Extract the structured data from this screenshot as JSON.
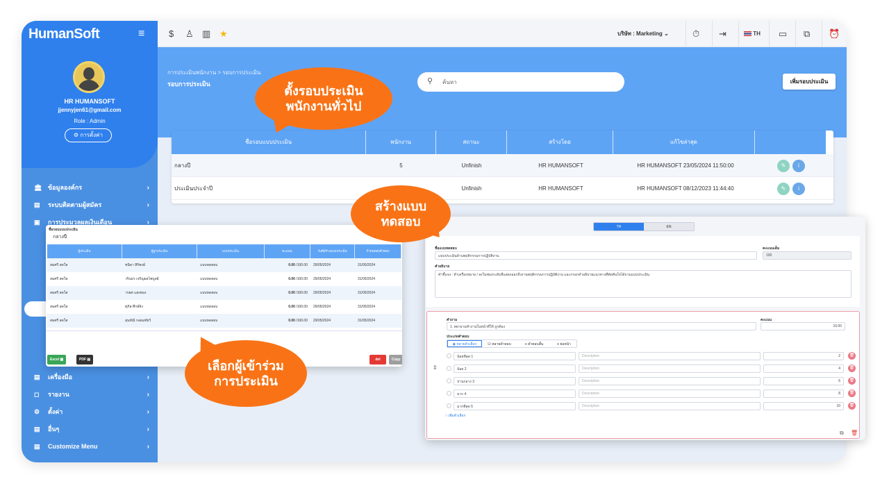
{
  "brand": "HumanSoft",
  "user": {
    "name": "HR HUMANSOFT",
    "email": "jjennyjen61@gmail.com",
    "role": "Role : Admin",
    "settings_label": "การตั้งค่า"
  },
  "sidebar": {
    "items": [
      {
        "label": "ข้อมูลองค์กร",
        "icon": "building-icon"
      },
      {
        "label": "ระบบติดตามผู้สมัคร",
        "icon": "briefcase-icon"
      },
      {
        "label": "การประมวลผลเงินเดือน",
        "icon": "payroll-icon"
      }
    ],
    "items_bottom": [
      {
        "label": "เครื่องมือ",
        "icon": "tools-icon"
      },
      {
        "label": "รายงาน",
        "icon": "report-icon"
      },
      {
        "label": "ตั้งค่า",
        "icon": "gear-icon"
      },
      {
        "label": "อื่นๆ",
        "icon": "more-icon"
      },
      {
        "label": "Customize Menu",
        "icon": "customize-icon"
      }
    ]
  },
  "topbar": {
    "company": "บริษัท : Marketing",
    "language": "TH",
    "icons": [
      "dollar-icon",
      "user-icon",
      "columns-icon",
      "star-icon",
      "timer-icon",
      "login-icon",
      "flag-icon",
      "chat-icon",
      "add-window-icon",
      "alarm-icon"
    ]
  },
  "header": {
    "breadcrumb": "การประเมินพนักงาน > รอบการประเมิน",
    "title": "รอบการประเมิน",
    "search_placeholder": "ค้นหา",
    "add_button": "เพิ่มรอบประเมิน"
  },
  "table": {
    "columns": [
      "ชื่อรอบแบบประเมิน",
      "พนักงาน",
      "สถานะ",
      "สร้างโดย",
      "แก้ไขล่าสุด"
    ],
    "rows": [
      {
        "name": "กลางปี",
        "employees": "5",
        "status": "Unfinish",
        "created_by": "HR HUMANSOFT",
        "updated": "HR HUMANSOFT 23/05/2024 11:50:00"
      },
      {
        "name": "ประเมินประจำปี",
        "employees": "",
        "status": "Unfinish",
        "created_by": "HR HUMANSOFT",
        "updated": "HR HUMANSOFT 08/12/2023 11:44:40"
      }
    ]
  },
  "participants": {
    "label": "ชื่อรอบแบบประเมิน",
    "value": "กลางปี",
    "columns": [
      "ผู้ประเมิน",
      "ผู้ถูกประเมิน",
      "แบบประเมิน",
      "คะแนน",
      "วันที่สร้างแบบประเมิน",
      "กำหนดส่งคำตอบ"
    ],
    "rows": [
      {
        "evaluator": "สมศรี สดใส",
        "evaluatee": "ชนิดา สิริพงษ์",
        "form": "แบบทดสอบ",
        "score": "0.00",
        "max": "/100.00",
        "created": "29/05/2024",
        "due": "31/05/2024"
      },
      {
        "evaluator": "สมศรี สดใส",
        "evaluatee": "วรินธร เจริญผลไพบูลย์",
        "form": "แบบทดสอบ",
        "score": "0.00",
        "max": "/100.00",
        "created": "29/05/2024",
        "due": "31/05/2024"
      },
      {
        "evaluator": "สมศรี สดใส",
        "evaluatee": "วรยศ แสงทอง",
        "form": "แบบทดสอบ",
        "score": "0.00",
        "max": "/100.00",
        "created": "29/05/2024",
        "due": "31/05/2024"
      },
      {
        "evaluator": "สมศรี สดใส",
        "evaluatee": "ศุภิส ศึกษ์จิง",
        "form": "แบบทดสอบ",
        "score": "0.00",
        "max": "/100.00",
        "created": "29/05/2024",
        "due": "31/05/2024"
      },
      {
        "evaluator": "สมศรี สดใส",
        "evaluatee": "สุนทัณี กล่อมชัยวิ",
        "form": "แบบทดสอบ",
        "score": "0.00",
        "max": "/100.00",
        "created": "29/05/2024",
        "due": "31/05/2024"
      }
    ],
    "excel_label": "Excel",
    "pdf_label": "PDF",
    "del_label": "del",
    "copy_label": "Copy"
  },
  "form": {
    "tabs": [
      "TH",
      "EN"
    ],
    "name_label": "ชื่อแบบทดสอบ",
    "name_value": "แบบประเมินด้านพฤติกรรมการปฏิบัติงาน",
    "full_score_label": "คะแนนเต็ม",
    "full_score_value": "100",
    "desc_label": "คำอธิบาย",
    "desc_value": "คำชี้แจง : ทำเครื่องหมาย / ลงในช่องระดับที่แสดงออกถึงงานพฤติกรรมการปฏิบัติงาน และกรอกคำอธิบายแนวทางที่ตัดสินใจได้ถามแบบประเมิน",
    "question_label": "คำถาม",
    "question_value": "1. พยายามทำงานในหน้าที่ให้ ถูกต้อง",
    "score_label": "คะแนน",
    "score_value": "10.00",
    "answer_type_label": "ประเภทคำตอบ",
    "answer_types": [
      "หลายตัวเลือก",
      "หลายคำตอบ",
      "คำตอบสั้น",
      "ย่อหน้า"
    ],
    "options": [
      {
        "label": "น้อยที่สุด 1",
        "desc": "Description",
        "score": "2"
      },
      {
        "label": "น้อย 2",
        "desc": "Description",
        "score": "4"
      },
      {
        "label": "ปานกลาง 3",
        "desc": "Description",
        "score": "6"
      },
      {
        "label": "มาก 4",
        "desc": "Description",
        "score": "8"
      },
      {
        "label": "มากที่สุด 5",
        "desc": "Description",
        "score": "10"
      }
    ],
    "add_option": "เพิ่มตัวเลือก"
  },
  "callouts": {
    "round": "ตั้งรอบประเมิน\nพนักงานทั่วไป",
    "create": "สร้างแบบ\nทดสอบ",
    "select": "เลือกผู้เข้าร่วม\nการประเมิน"
  },
  "colors": {
    "primary": "#2f80ed",
    "header": "#5ea4f5",
    "callout": "#f97316",
    "danger": "#e97a86"
  }
}
